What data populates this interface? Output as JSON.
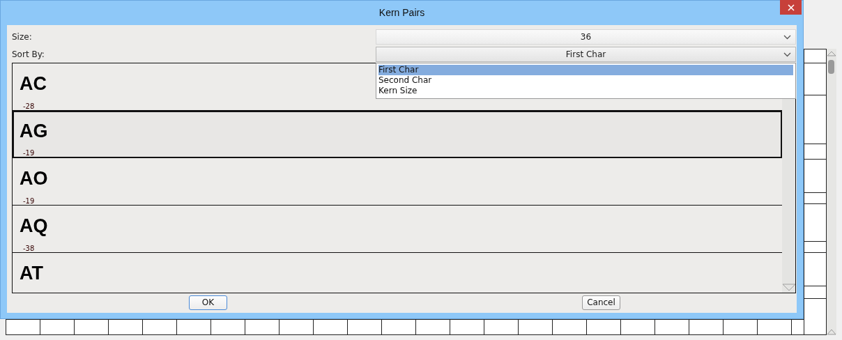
{
  "window": {
    "title": "Kern Pairs"
  },
  "size": {
    "label": "Size:",
    "value": "36"
  },
  "sort_by": {
    "label": "Sort By:",
    "value": "First Char",
    "expanded": true,
    "options": [
      {
        "label": "First Char",
        "selected": true
      },
      {
        "label": "Second Char",
        "selected": false
      },
      {
        "label": "Kern Size",
        "selected": false
      }
    ]
  },
  "pairs": [
    {
      "pair": "AC",
      "kern": "-28",
      "selected": false
    },
    {
      "pair": "AG",
      "kern": "-19",
      "selected": true
    },
    {
      "pair": "AO",
      "kern": "-19",
      "selected": false
    },
    {
      "pair": "AQ",
      "kern": "-38",
      "selected": false
    },
    {
      "pair": "AT",
      "selected": false
    }
  ],
  "buttons": [
    {
      "label": "OK"
    },
    {
      "label": "Cancel"
    }
  ]
}
